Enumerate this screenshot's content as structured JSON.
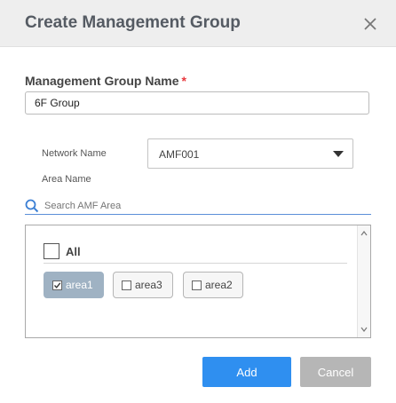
{
  "dialog": {
    "title": "Create Management Group"
  },
  "form": {
    "group_name_label": "Management Group Name",
    "required_mark": "*",
    "group_name_value": "6F Group",
    "network_name_label": "Network Name",
    "network_name_value": "AMF001",
    "area_name_label": "Area Name",
    "search_placeholder": "Search AMF Area"
  },
  "areas": {
    "all_label": "All",
    "all_checked": false,
    "items": [
      {
        "label": "area1",
        "checked": true
      },
      {
        "label": "area3",
        "checked": false
      },
      {
        "label": "area2",
        "checked": false
      }
    ]
  },
  "buttons": {
    "add_label": "Add",
    "cancel_label": "Cancel"
  },
  "colors": {
    "accent": "#2f8ff0",
    "selected_chip": "#9fb2c3",
    "disabled_button": "#b6b6b6",
    "required": "#e8383d"
  },
  "icons": {
    "close": "close-icon",
    "dropdown": "chevron-down-icon",
    "search": "search-icon",
    "checkbox_checked": "checkmark-icon"
  }
}
